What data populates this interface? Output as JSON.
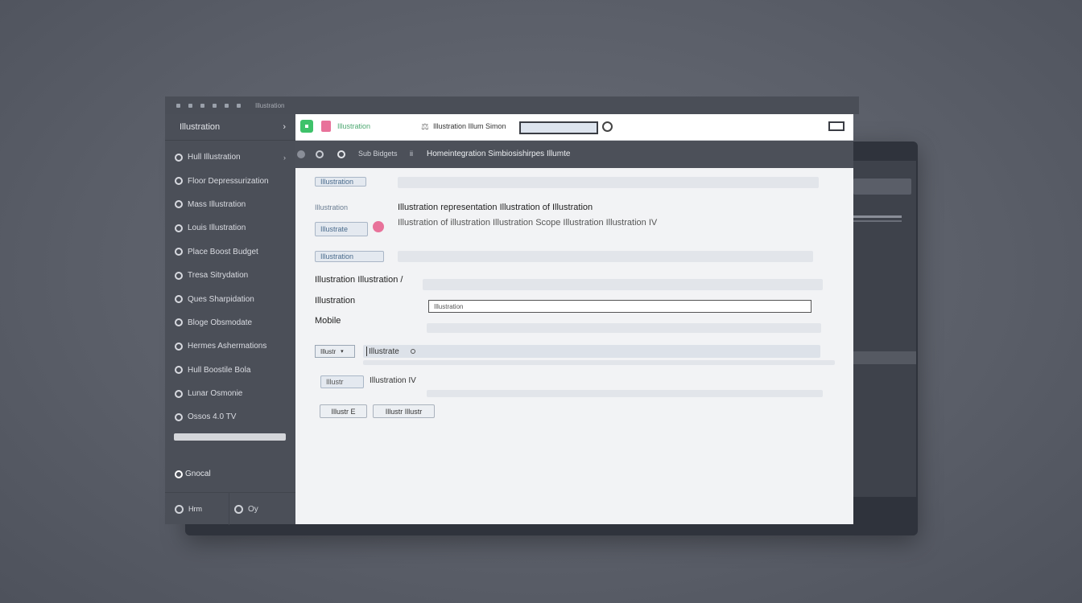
{
  "window": {
    "title": "Illustration"
  },
  "sidebar": {
    "header": "Illustration",
    "items": [
      {
        "label": "Hull Illustration"
      },
      {
        "label": "Floor Depressurization"
      },
      {
        "label": "Mass Illustration"
      },
      {
        "label": "Louis Illustration"
      },
      {
        "label": "Place Boost Budget"
      },
      {
        "label": "Tresa Sitrydation"
      },
      {
        "label": "Ques Sharpidation"
      },
      {
        "label": "Bloge Obsmodate"
      },
      {
        "label": "Hermes Ashermations"
      },
      {
        "label": "Hull Boostile Bola"
      },
      {
        "label": "Lunar Osmonie"
      },
      {
        "label": "Ossos 4.0 TV"
      }
    ],
    "new_label": "Gnocal",
    "footer_left": "Hrm",
    "footer_right": "Oy"
  },
  "topbar": {
    "app_name": "Illustration",
    "label": "Illustration Illum Simon",
    "search_value": ""
  },
  "navbar": {
    "crumb": "Sub Bidgets",
    "separator": "ii",
    "title": "Homeintegration Simbiosishirpes Illumte"
  },
  "form": {
    "chip1": "Illustration",
    "small_label": "Illustration",
    "chip2": "Illustrate",
    "desc_title": "Illustration representation Illustration of Illustration",
    "desc_sub": "Illustration of illustration Illustration Scope Illustration Illustration IV",
    "chip3": "Illustration",
    "field1_label": "Illustration Illustration /",
    "field2_label": "Illustration",
    "field3_label": "Mobile",
    "input_value": "Illustration",
    "dropdown_value": "Illustr",
    "filter_value": "Illustrate",
    "row_chip": "Illustr",
    "row_label": "Illustration IV",
    "btn1": "Illustr E",
    "btn2": "Illustr Illustr"
  },
  "colors": {
    "accent_green": "#3ec26a",
    "accent_pink": "#e8729a",
    "sidebar_bg": "#4b4f58"
  }
}
